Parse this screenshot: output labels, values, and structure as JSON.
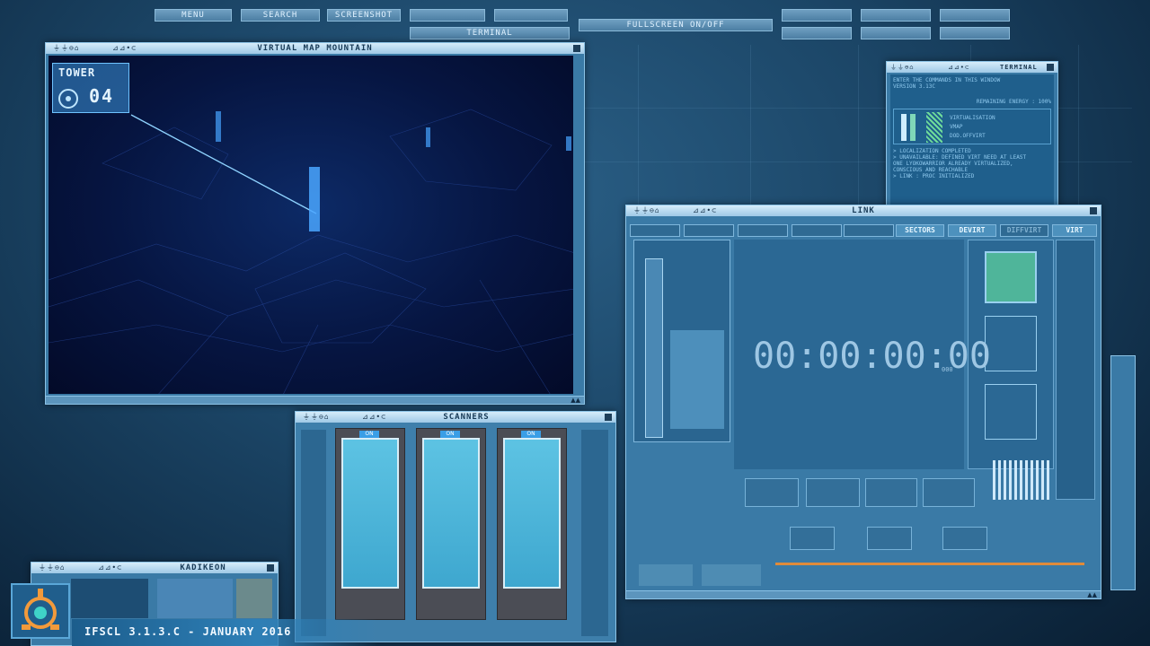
{
  "menu": {
    "menu_label": "MENU",
    "search_label": "SEARCH",
    "screenshot_label": "SCREENSHOT",
    "terminal_label": "TERMINAL",
    "fullscreen_label": "FULLSCREEN ON/OFF"
  },
  "window_controls": {
    "left": "⏚⏚⊖⌂",
    "mid": "⊿⊿•⊂"
  },
  "map_window": {
    "title": "VIRTUAL MAP MOUNTAIN",
    "tower_label": "TOWER",
    "tower_number": "04"
  },
  "terminal_window": {
    "title": "TERMINAL",
    "intro": "ENTER THE COMMANDS IN THIS WINDOW",
    "version": "VERSION 3.13C",
    "energy": "REMAINING ENERGY : 100%",
    "virt_items": [
      "VIRTUALISATION",
      "VMAP",
      "DOD.OFFVIRT"
    ],
    "log": [
      "> LOCALIZATION COMPLETED",
      "> UNAVAILABLE: DEFINED VIRT NEED AT LEAST",
      "ONE LYOKOWARRIOR ALREADY VIRTUALIZED,",
      "CONSCIOUS AND REACHABLE",
      "> LINK : PROC INITIALIZED"
    ]
  },
  "link_window": {
    "title": "LINK",
    "tabs": [
      "SECTORS",
      "DEVIRT",
      "DIFFVIRT",
      "VIRT"
    ],
    "timer": "00:00:00:00",
    "timer_ms": "000"
  },
  "scanners_window": {
    "title": "SCANNERS",
    "status": [
      "ON",
      "ON",
      "ON"
    ]
  },
  "kadikeon_window": {
    "title": "KADIKEON"
  },
  "footer": {
    "version_text": "IFSCL 3.1.3.C - JANUARY 2016"
  }
}
